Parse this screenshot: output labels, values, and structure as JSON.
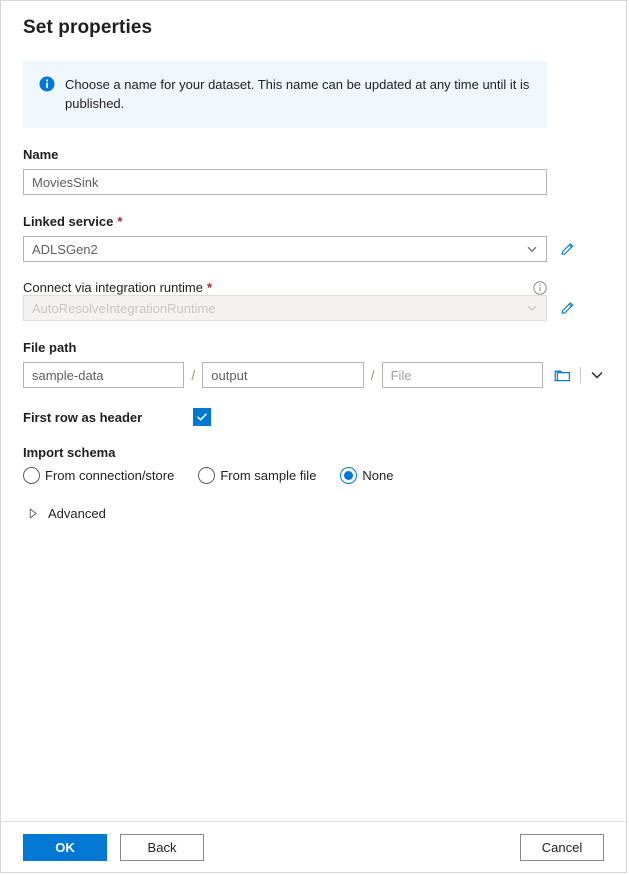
{
  "dialog": {
    "title": "Set properties"
  },
  "info_banner": {
    "icon": "info-circle-icon",
    "text": "Choose a name for your dataset. This name can be updated at any time until it is published.",
    "background": "#eff6fc",
    "icon_color": "#0078d4"
  },
  "fields": {
    "name": {
      "label": "Name",
      "value": "MoviesSink"
    },
    "linked_service": {
      "label": "Linked service",
      "required_marker": "*",
      "value": "ADLSGen2",
      "edit_icon": "pencil-icon",
      "caret_icon": "chevron-down-icon"
    },
    "integration_runtime": {
      "label": "Connect via integration runtime",
      "required_marker": "*",
      "value": "AutoResolveIntegrationRuntime",
      "disabled": true,
      "info_icon": "info-outline-icon",
      "edit_icon": "pencil-icon",
      "caret_icon": "chevron-down-icon"
    },
    "file_path": {
      "label": "File path",
      "container": "sample-data",
      "directory": "output",
      "file_placeholder": "File",
      "file_value": "",
      "separator": "/",
      "browse_icon": "folder-icon",
      "caret_icon": "chevron-down-icon"
    },
    "first_row_as_header": {
      "label": "First row as header",
      "checked": true,
      "check_icon": "checkmark-icon"
    },
    "import_schema": {
      "label": "Import schema",
      "options": [
        {
          "label": "From connection/store",
          "selected": false
        },
        {
          "label": "From sample file",
          "selected": false
        },
        {
          "label": "None",
          "selected": true
        }
      ]
    },
    "advanced": {
      "label": "Advanced",
      "expanded": false,
      "icon": "triangle-right-icon"
    }
  },
  "footer": {
    "ok_label": "OK",
    "back_label": "Back",
    "cancel_label": "Cancel"
  },
  "colors": {
    "accent": "#0078d4",
    "required": "#a4262c",
    "banner_bg": "#eff6fc",
    "border": "#b3b3b3"
  }
}
